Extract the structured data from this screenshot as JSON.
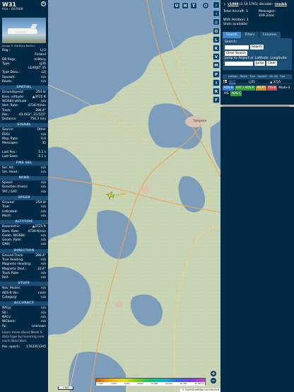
{
  "info": {
    "callsign": "W31",
    "hex": "Hex : 467888",
    "photo_credit": "Image © Matthias Becker",
    "close_icon": "close-icon",
    "rows_top": [
      {
        "k": "Reg.:",
        "v": "LJ-2"
      },
      {
        "k": "",
        "v": "Finland"
      },
      {
        "k": "DB flags:",
        "v": "military"
      },
      {
        "k": "Type:",
        "v": "LJ35"
      },
      {
        "k": "",
        "v": "LEARJET 35"
      },
      {
        "k": "Type Desc.:",
        "v": "L2J"
      },
      {
        "k": "Squawk:",
        "v": "n/a"
      },
      {
        "k": "Route:",
        "v": "n/a"
      }
    ],
    "sections": [
      {
        "title": "SPATIAL",
        "rows": [
          {
            "k": "Groundspeed:",
            "v": "254 kt"
          },
          {
            "k": "Baro. altitude:",
            "v": "▲3725 ft"
          },
          {
            "k": "WGS84 altitude:",
            "v": "n/a"
          },
          {
            "k": "Vert. Rate:",
            "v": "4736 ft/min"
          },
          {
            "k": "Track:",
            "v": "286.4°"
          },
          {
            "k": "Pos.:",
            "v": "61.403°, 23.515°"
          },
          {
            "k": "Distance:",
            "v": "750.3 nmi"
          }
        ]
      },
      {
        "title": "SIGNAL",
        "rows": [
          {
            "k": "Source:",
            "v": "Other"
          },
          {
            "k": "RSSI:",
            "v": "n/a"
          },
          {
            "k": "Msg. Rate:",
            "v": "0.0"
          },
          {
            "k": "Messages:",
            "v": "35"
          },
          {
            "k": "",
            "v": ""
          },
          {
            "k": "Last Pos.:",
            "v": "5.1 s"
          },
          {
            "k": "Last Seen:",
            "v": "5.1 s"
          }
        ]
      },
      {
        "title": "FMS SEL",
        "rows": [
          {
            "k": "Sel. Alt.:",
            "v": "n/a"
          },
          {
            "k": "Sel. Head.:",
            "v": "n/a"
          }
        ]
      },
      {
        "title": "WIND",
        "rows": [
          {
            "k": "Speed:",
            "v": "n/a"
          },
          {
            "k": "Direction (from):",
            "v": "n/a"
          },
          {
            "k": "TAT / OAT:",
            "v": "n/a"
          }
        ]
      },
      {
        "title": "SPEED",
        "rows": [
          {
            "k": "Ground:",
            "v": "254 kt"
          },
          {
            "k": "True:",
            "v": "n/a"
          },
          {
            "k": "Indicated:",
            "v": "n/a"
          },
          {
            "k": "Mach:",
            "v": "n/a"
          }
        ]
      },
      {
        "title": "ALTITUDE",
        "rows": [
          {
            "k": "Barometric:",
            "v": "▲3725 ft"
          },
          {
            "k": "Baro. Rate:",
            "v": "4736 ft/min"
          },
          {
            "k": "Geom. WGS84:",
            "v": "n/a"
          },
          {
            "k": "Geom. Rate:",
            "v": "n/a"
          },
          {
            "k": "QNH:",
            "v": "n/a"
          }
        ]
      },
      {
        "title": "DIRECTION",
        "rows": [
          {
            "k": "Ground Track:",
            "v": "286.4°"
          },
          {
            "k": "True Heading:",
            "v": "n/a"
          },
          {
            "k": "Magnetic Heading:",
            "v": "n/a"
          },
          {
            "k": "Magnetic Decl.:",
            "v": "10.4°"
          },
          {
            "k": "Track Rate:",
            "v": "n/a"
          },
          {
            "k": "Roll:",
            "v": "n/a"
          }
        ]
      },
      {
        "title": "STUFF",
        "rows": [
          {
            "k": "Nav. Modes:",
            "v": "n/a"
          },
          {
            "k": "ADS-B Ver.:",
            "v": "none"
          },
          {
            "k": "Category:",
            "v": "n/a"
          }
        ]
      },
      {
        "title": "ACCURACY",
        "rows": [
          {
            "k": "NACp:",
            "v": "n/a"
          },
          {
            "k": "SIL:",
            "v": "n/a"
          },
          {
            "k": "NACv:",
            "v": "n/a"
          },
          {
            "k": "NICbaro:",
            "v": "n/a"
          },
          {
            "k": "Rc:",
            "v": "unknown"
          }
        ]
      }
    ],
    "note": "Learn more about Mode S data type by hovering over each data label.",
    "pos_epoch_label": "Pos. epoch:",
    "pos_epoch_value": "1763351345"
  },
  "map": {
    "top_buttons": [
      "U",
      "H",
      "T"
    ],
    "aircraft_icon": "aircraft-icon",
    "altitude_scale_labels": [
      "2 000",
      "4 000",
      "6 000",
      "8 000",
      "10 000",
      "20 000",
      "30 000",
      "40 000 ft"
    ],
    "scale_label": "2 NM",
    "attribution": "© OpenStreetMap contributors",
    "city_label": "Tampere",
    "zoom_in": "+",
    "zoom_out": "−"
  },
  "toolbar": {
    "buttons": [
      "›",
      "‹",
      "◎",
      "O",
      "L",
      "K",
      "V",
      "M",
      "P",
      "I",
      "R",
      "F"
    ]
  },
  "sidebar": {
    "version": "v1098",
    "version_detail": "(3.14.1791) decoder:",
    "decoder": "readsb",
    "stats": {
      "total_label": "Total Aircraft: 1",
      "messages_label": "Messages:",
      "messages_value": "439.2/sec",
      "with_position": "With Position: 1",
      "stats_available": "Stats available"
    },
    "tabs": [
      "Search",
      "Filters",
      "Columns"
    ],
    "search": {
      "label": "Search:",
      "search_button": "Search",
      "clear_button": "Clear Search",
      "jump_label": "Jump to Airport or Latitude, Longitude:",
      "jump_button": "Jump",
      "jump_clear": "Clear"
    },
    "table_headers": [
      "Callsign",
      "Route",
      "Type",
      "Squawk",
      "Alt. (ft)",
      "Spd."
    ],
    "rows": [
      {
        "callsign": "W31",
        "type": "LJ35",
        "alt": "▲ 3725"
      }
    ],
    "badges": [
      {
        "label": "ADS-B",
        "color": "#2b7fd8"
      },
      {
        "label": "UAT / ADS-R",
        "color": "#2e9b2e"
      },
      {
        "label": "MLAT",
        "color": "#d18a1b"
      },
      {
        "label": "TIS-B",
        "color": "#d14747"
      },
      {
        "label": "Mode-S",
        "color": "#002945"
      },
      {
        "label": "AIS",
        "color": "#002945"
      },
      {
        "label": "ADS-C",
        "color": "#2e9b2e"
      }
    ]
  }
}
